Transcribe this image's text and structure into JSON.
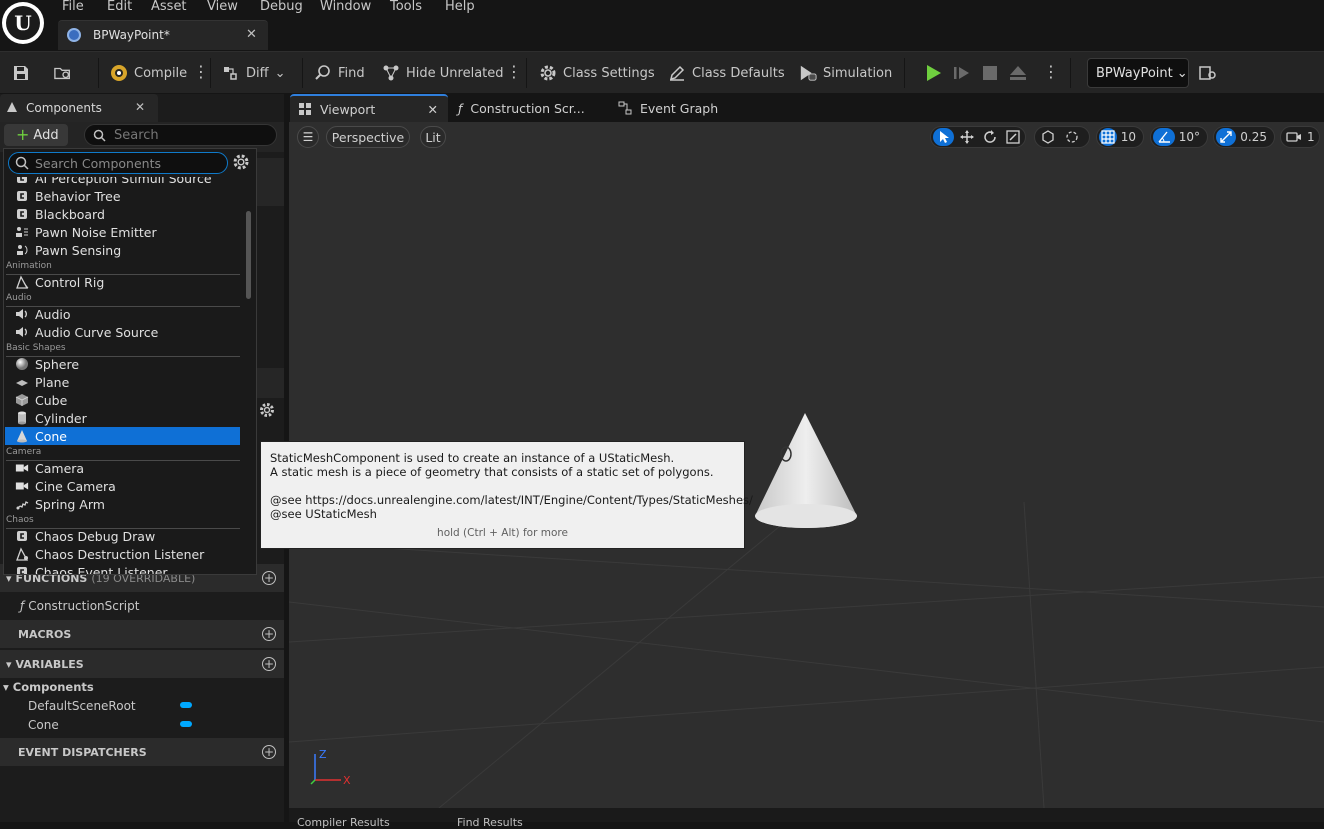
{
  "menu": [
    "File",
    "Edit",
    "Asset",
    "View",
    "Debug",
    "Window",
    "Tools",
    "Help"
  ],
  "document_tab": {
    "label": "BPWayPoint*"
  },
  "toolbar": {
    "compile": "Compile",
    "diff": "Diff",
    "find": "Find",
    "hide_unrelated": "Hide Unrelated",
    "class_settings": "Class Settings",
    "class_defaults": "Class Defaults",
    "simulation": "Simulation",
    "debug_object": "BPWayPoint"
  },
  "components_panel": {
    "tab_label": "Components",
    "add_label": "Add",
    "search_placeholder": "Search"
  },
  "dropdown": {
    "search_placeholder": "Search Components",
    "partial_top": "AI Perception Stimuli Source",
    "items": [
      {
        "label": "Behavior Tree",
        "icon": "component-icon"
      },
      {
        "label": "Blackboard",
        "icon": "component-icon"
      },
      {
        "label": "Pawn Noise Emitter",
        "icon": "noise-emitter-icon"
      },
      {
        "label": "Pawn Sensing",
        "icon": "sensing-icon"
      },
      {
        "category": "Animation"
      },
      {
        "label": "Control Rig",
        "icon": "control-rig-icon"
      },
      {
        "category": "Audio"
      },
      {
        "label": "Audio",
        "icon": "speaker-icon"
      },
      {
        "label": "Audio Curve Source",
        "icon": "speaker-icon"
      },
      {
        "category": "Basic Shapes"
      },
      {
        "label": "Sphere",
        "icon": "sphere-icon"
      },
      {
        "label": "Plane",
        "icon": "plane-icon"
      },
      {
        "label": "Cube",
        "icon": "cube-icon"
      },
      {
        "label": "Cylinder",
        "icon": "cylinder-icon"
      },
      {
        "label": "Cone",
        "icon": "cone-icon",
        "selected": true
      },
      {
        "category": "Camera"
      },
      {
        "label": "Camera",
        "icon": "camera-icon"
      },
      {
        "label": "Cine Camera",
        "icon": "camera-icon"
      },
      {
        "label": "Spring Arm",
        "icon": "spring-arm-icon"
      },
      {
        "category": "Chaos"
      },
      {
        "label": "Chaos Debug Draw",
        "icon": "component-icon"
      },
      {
        "label": "Chaos Destruction Listener",
        "icon": "listener-icon"
      },
      {
        "label": "Chaos Event Listener",
        "icon": "component-icon"
      }
    ]
  },
  "my_blueprint": {
    "functions_label": "FUNCTIONS",
    "functions_count": "(19 OVERRIDABLE)",
    "construction_script": "ConstructionScript",
    "macros_label": "MACROS",
    "variables_label": "VARIABLES",
    "components_group": "Components",
    "variables": [
      "DefaultSceneRoot",
      "Cone"
    ],
    "event_dispatchers_label": "EVENT DISPATCHERS"
  },
  "editor_tabs": {
    "viewport": "Viewport",
    "construction": "Construction Scr...",
    "event_graph": "Event Graph"
  },
  "viewport_toolbar": {
    "perspective": "Perspective",
    "lit": "Lit",
    "grid_snap": "10",
    "rotation_snap": "10°",
    "scale_snap": "0.25",
    "camera_speed": "1"
  },
  "tooltip": {
    "line1": "StaticMeshComponent is used to create an instance of a UStaticMesh.",
    "line2": "A static mesh is a piece of geometry that consists of a static set of polygons.",
    "line3": "@see https://docs.unrealengine.com/latest/INT/Engine/Content/Types/StaticMeshes/",
    "line4": "@see UStaticMesh",
    "hint": "hold (Ctrl + Alt) for more"
  },
  "axes": {
    "z": "Z",
    "x": "X"
  },
  "bottom_tabs": {
    "compiler": "Compiler Results",
    "find": "Find Results"
  },
  "colors": {
    "accent": "#0f70d6",
    "play": "#6fcf3f",
    "variable_pill": "#00a8ff"
  }
}
